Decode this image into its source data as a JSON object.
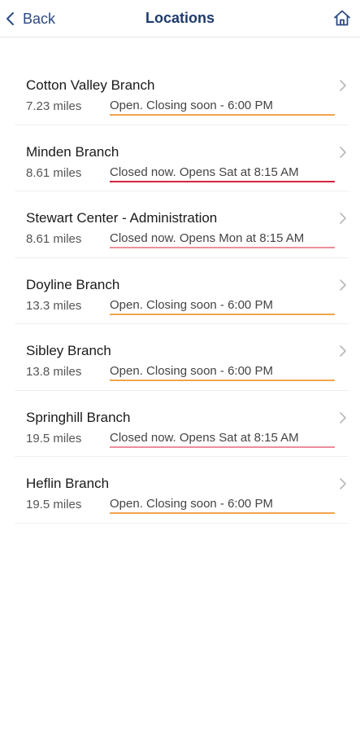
{
  "colors": {
    "accent": "#2b4a84",
    "title": "#1e3a6e",
    "open_soon": "#f0a54c",
    "closed": "#d6243d",
    "closed_light": "#ee8e9a"
  },
  "header": {
    "back_label": "Back",
    "title": "Locations",
    "home_icon": "home-icon",
    "back_icon": "chevron-left-icon"
  },
  "locations": [
    {
      "name": "Cotton Valley Branch",
      "distance": "7.23 miles",
      "status": "Open. Closing soon - 6:00 PM",
      "status_type": "open_soon"
    },
    {
      "name": "Minden Branch",
      "distance": "8.61 miles",
      "status": "Closed now. Opens Sat at 8:15 AM",
      "status_type": "closed"
    },
    {
      "name": "Stewart Center - Administration",
      "distance": "8.61 miles",
      "status": "Closed now. Opens Mon at 8:15 AM",
      "status_type": "closed_light"
    },
    {
      "name": "Doyline Branch",
      "distance": "13.3 miles",
      "status": "Open. Closing soon - 6:00 PM",
      "status_type": "open_soon"
    },
    {
      "name": "Sibley Branch",
      "distance": "13.8 miles",
      "status": "Open. Closing soon - 6:00 PM",
      "status_type": "open_soon"
    },
    {
      "name": "Springhill Branch",
      "distance": "19.5 miles",
      "status": "Closed now. Opens Sat at 8:15 AM",
      "status_type": "closed_light"
    },
    {
      "name": "Heflin Branch",
      "distance": "19.5 miles",
      "status": "Open. Closing soon - 6:00 PM",
      "status_type": "open_soon"
    }
  ]
}
